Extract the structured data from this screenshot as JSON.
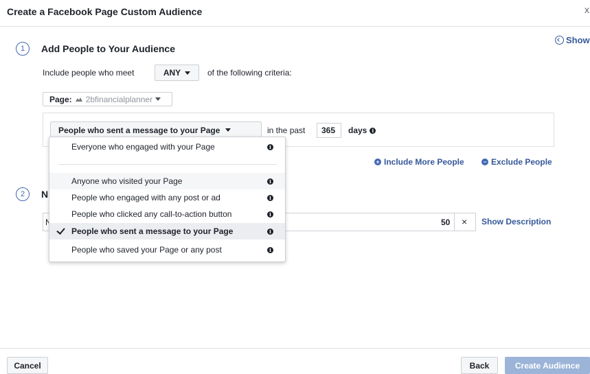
{
  "dialog": {
    "title": "Create a Facebook Page Custom Audience",
    "close": "x"
  },
  "show_link": "Show",
  "step1": {
    "num": "1",
    "title": "Add People to Your Audience",
    "criteria_pre": "Include people who meet",
    "match": "ANY",
    "criteria_post": "of the following criteria:",
    "page_label": "Page:",
    "page_value": "2bfinancialplanner",
    "type_selected": "People who sent a message to your Page",
    "in_past": "in the past",
    "days_value": "365",
    "days_label": "days",
    "include_more": "Include More People",
    "exclude": "Exclude People"
  },
  "step2": {
    "num": "2",
    "title_partial": "N",
    "input_partial": "N",
    "char_count": "50",
    "clear": "×",
    "show_description": "Show Description"
  },
  "menu": {
    "items": [
      {
        "label": "Everyone who engaged with your Page"
      },
      {
        "label": "Anyone who visited your Page"
      },
      {
        "label": "People who engaged with any post or ad"
      },
      {
        "label": "People who clicked any call-to-action button"
      },
      {
        "label": "People who sent a message to your Page",
        "selected": true
      },
      {
        "label": "People who saved your Page or any post"
      }
    ]
  },
  "footer": {
    "cancel": "Cancel",
    "back": "Back",
    "create": "Create Audience"
  },
  "colors": {
    "link": "#365899",
    "primary_disabled": "#9cb4d8",
    "accent": "#4267b2"
  }
}
